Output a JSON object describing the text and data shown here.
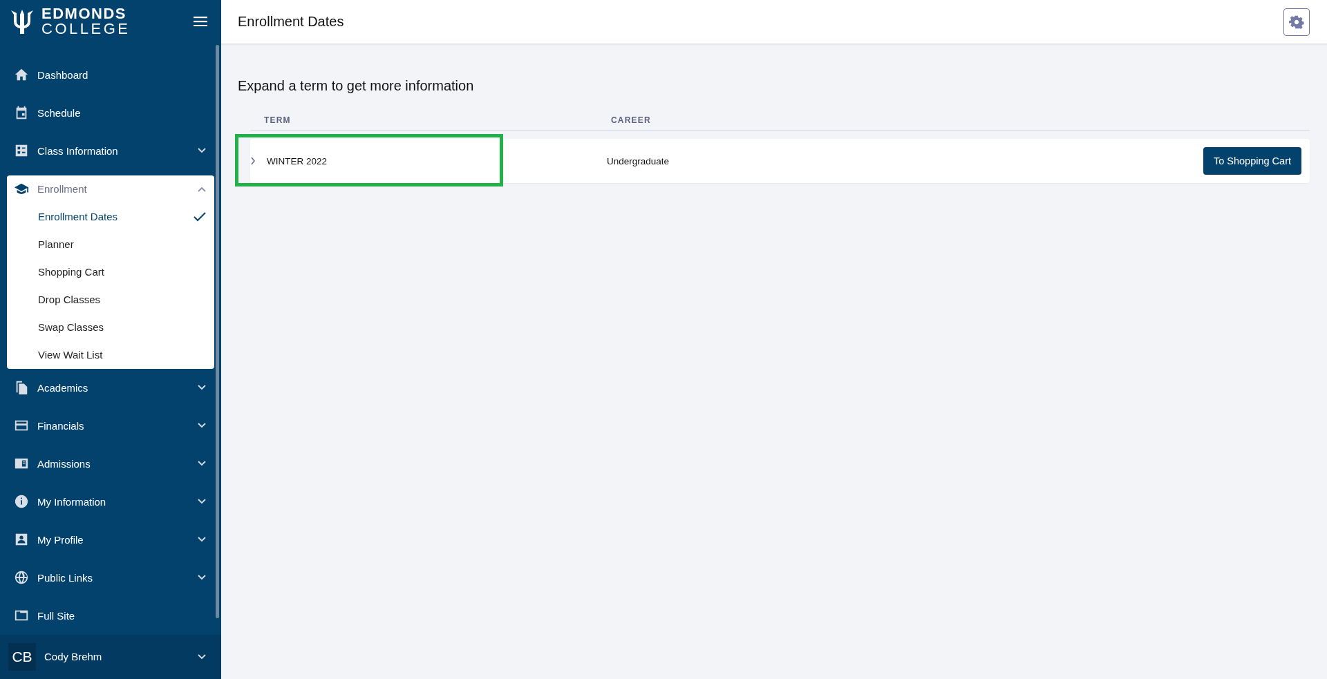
{
  "logo": {
    "line_1": "EDMONDS",
    "line_2": "COLLEGE"
  },
  "sidebar": {
    "items": [
      {
        "label": "Dashboard",
        "kind": "link"
      },
      {
        "label": "Schedule",
        "kind": "link"
      },
      {
        "label": "Class Information",
        "kind": "menu",
        "expanded": false
      },
      {
        "label": "Enrollment",
        "kind": "menu",
        "expanded": true,
        "children": [
          {
            "label": "Enrollment Dates",
            "selected": true
          },
          {
            "label": "Planner",
            "selected": false
          },
          {
            "label": "Shopping Cart",
            "selected": false
          },
          {
            "label": "Drop Classes",
            "selected": false
          },
          {
            "label": "Swap Classes",
            "selected": false
          },
          {
            "label": "View Wait List",
            "selected": false
          }
        ]
      },
      {
        "label": "Academics",
        "kind": "menu",
        "expanded": false
      },
      {
        "label": "Financials",
        "kind": "menu",
        "expanded": false
      },
      {
        "label": "Admissions",
        "kind": "menu",
        "expanded": false
      },
      {
        "label": "My Information",
        "kind": "menu",
        "expanded": false
      },
      {
        "label": "My Profile",
        "kind": "menu",
        "expanded": false
      },
      {
        "label": "Public Links",
        "kind": "menu",
        "expanded": false
      },
      {
        "label": "Full Site",
        "kind": "link"
      }
    ]
  },
  "user": {
    "initials": "CB",
    "name": "Cody Brehm"
  },
  "header": {
    "title": "Enrollment Dates"
  },
  "content": {
    "heading": "Expand a term to get more information",
    "table": {
      "columns": [
        "TERM",
        "CAREER"
      ],
      "rows": [
        {
          "term": "WINTER 2022",
          "career": "Undergraduate",
          "expanded": false,
          "term_highlighted": true,
          "button": "To Shopping Cart"
        }
      ]
    }
  }
}
